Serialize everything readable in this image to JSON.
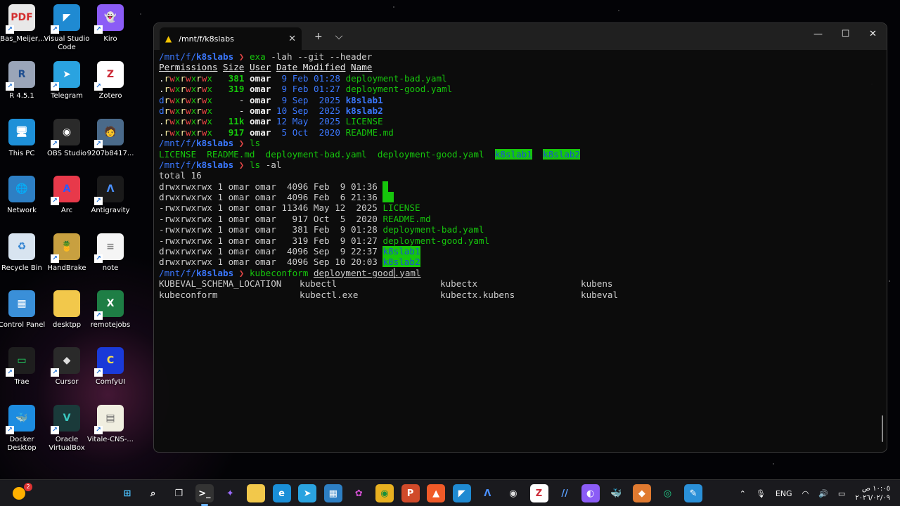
{
  "desktop": {
    "icons": [
      {
        "label": "_Bas_Meijer,...",
        "glyph": "PDF",
        "bg": "#e8e8e8",
        "fg": "#d32f2f"
      },
      {
        "label": "Visual Studio Code",
        "glyph": "◤",
        "bg": "#1f8ad2",
        "fg": "#ffffff"
      },
      {
        "label": "Kiro",
        "glyph": "👻",
        "bg": "#8b5cf6",
        "fg": "#ffffff"
      },
      {
        "label": "R 4.5.1",
        "glyph": "R",
        "bg": "#9aa5b8",
        "fg": "#1d4d8f"
      },
      {
        "label": "Telegram",
        "glyph": "➤",
        "bg": "#2aa3e0",
        "fg": "#ffffff"
      },
      {
        "label": "Zotero",
        "glyph": "Z",
        "bg": "#ffffff",
        "fg": "#cc2936"
      },
      {
        "label": "This PC",
        "glyph": "🖥",
        "bg": "#1e90d8",
        "fg": "#ffffff"
      },
      {
        "label": "OBS Studio",
        "glyph": "◉",
        "bg": "#2a2a2a",
        "fg": "#ffffff"
      },
      {
        "label": "9207b8417...",
        "glyph": "🧑",
        "bg": "#4a6a8a",
        "fg": "#ffffff"
      },
      {
        "label": "Network",
        "glyph": "🌐",
        "bg": "#2d7fc4",
        "fg": "#ffffff"
      },
      {
        "label": "Arc",
        "glyph": "A",
        "bg": "#e8394a",
        "fg": "#2d5bff"
      },
      {
        "label": "Antigravity",
        "glyph": "Λ",
        "bg": "#1a1a1a",
        "fg": "#4a90ff"
      },
      {
        "label": "Recycle Bin",
        "glyph": "♻",
        "bg": "#d8e4f0",
        "fg": "#2a7fd0"
      },
      {
        "label": "HandBrake",
        "glyph": "🍍",
        "bg": "#c8a040",
        "fg": "#ffffff"
      },
      {
        "label": "note",
        "glyph": "≡",
        "bg": "#f5f5f5",
        "fg": "#888888"
      },
      {
        "label": "Control Panel",
        "glyph": "▦",
        "bg": "#3a8fd8",
        "fg": "#ffffff"
      },
      {
        "label": "desktpp",
        "glyph": "",
        "bg": "#f2c84b",
        "fg": "#ffffff"
      },
      {
        "label": "remotejobs",
        "glyph": "X",
        "bg": "#1e7e45",
        "fg": "#ffffff"
      },
      {
        "label": "Trae",
        "glyph": "▭",
        "bg": "#1e1e1e",
        "fg": "#22dd66"
      },
      {
        "label": "Cursor",
        "glyph": "◆",
        "bg": "#2a2a2a",
        "fg": "#dddddd"
      },
      {
        "label": "ComfyUI",
        "glyph": "C",
        "bg": "#1a3ad8",
        "fg": "#ffe14a"
      },
      {
        "label": "Docker Desktop",
        "glyph": "🐳",
        "bg": "#1d8ce0",
        "fg": "#ffffff"
      },
      {
        "label": "Oracle VirtualBox",
        "glyph": "V",
        "bg": "#1a3a3a",
        "fg": "#3ac8c0"
      },
      {
        "label": "Vitale-CNS-...",
        "glyph": "▤",
        "bg": "#f0eee0",
        "fg": "#666666"
      }
    ]
  },
  "terminal": {
    "tab_title": "/mnt/f/k8slabs",
    "tab_icon": "penguin-icon",
    "new_tab": "+",
    "dropdown": "⌵",
    "controls": {
      "minimize": "—",
      "maximize": "☐",
      "close": "✕"
    },
    "prompt_path": "/mnt/f/",
    "prompt_dir": "k8slabs",
    "prompt_char": "❯",
    "cmd1": {
      "cmd": "exa",
      "args": " -lah --git --header"
    },
    "exa_header": [
      "Permissions",
      "Size",
      "User",
      "Date Modified",
      "Name"
    ],
    "exa_rows": [
      {
        "type": ".",
        "perm": "rwxrwxrwx",
        "size": "381",
        "user": "omar",
        "date": " 9 Feb 01:28",
        "name": "deployment-bad.yaml",
        "dir": false
      },
      {
        "type": ".",
        "perm": "rwxrwxrwx",
        "size": "319",
        "user": "omar",
        "date": " 9 Feb 01:27",
        "name": "deployment-good.yaml",
        "dir": false
      },
      {
        "type": "d",
        "perm": "rwxrwxrwx",
        "size": "-",
        "user": "omar",
        "date": " 9 Sep  2025",
        "name": "k8slab1",
        "dir": true
      },
      {
        "type": "d",
        "perm": "rwxrwxrwx",
        "size": "-",
        "user": "omar",
        "date": "10 Sep  2025",
        "name": "k8slab2",
        "dir": true
      },
      {
        "type": ".",
        "perm": "rwxrwxrwx",
        "size": "11k",
        "user": "omar",
        "date": "12 May  2025",
        "name": "LICENSE",
        "dir": false
      },
      {
        "type": ".",
        "perm": "rwxrwxrwx",
        "size": "917",
        "user": "omar",
        "date": " 5 Oct  2020",
        "name": "README.md",
        "dir": false
      }
    ],
    "cmd2": {
      "cmd": "ls"
    },
    "ls_files": [
      "LICENSE",
      "README.md",
      "deployment-bad.yaml",
      "deployment-good.yaml"
    ],
    "ls_dirs": [
      "k8slab1",
      "k8slab2"
    ],
    "cmd3": {
      "cmd": "ls",
      "args": " -al"
    },
    "total": "total 16",
    "lsal_rows": [
      {
        "meta": "drwxrwxrwx 1 omar omar  4096 Feb  9 01:36 ",
        "name": ".",
        "kind": "block"
      },
      {
        "meta": "drwxrwxrwx 1 omar omar  4096 Feb  6 21:36 ",
        "name": "..",
        "kind": "block"
      },
      {
        "meta": "-rwxrwxrwx 1 omar omar 11346 May 12  2025 ",
        "name": "LICENSE",
        "kind": "file"
      },
      {
        "meta": "-rwxrwxrwx 1 omar omar   917 Oct  5  2020 ",
        "name": "README.md",
        "kind": "file"
      },
      {
        "meta": "-rwxrwxrwx 1 omar omar   381 Feb  9 01:28 ",
        "name": "deployment-bad.yaml",
        "kind": "file"
      },
      {
        "meta": "-rwxrwxrwx 1 omar omar   319 Feb  9 01:27 ",
        "name": "deployment-good.yaml",
        "kind": "file"
      },
      {
        "meta": "drwxrwxrwx 1 omar omar  4096 Sep  9 22:37 ",
        "name": "k8slab1",
        "kind": "dir"
      },
      {
        "meta": "drwxrwxrwx 1 omar omar  4096 Sep 10 20:03 ",
        "name": "k8slab2",
        "kind": "dir"
      }
    ],
    "cmd4": {
      "cmd": "kubeconform",
      "arg_before_cursor": "deployment-good",
      "arg_after_cursor": ".yaml"
    },
    "completions": [
      [
        "KUBEVAL_SCHEMA_LOCATION",
        "kubectl",
        "kubectx",
        "kubens"
      ],
      [
        "kubeconform",
        "kubectl.exe",
        "kubectx.kubens",
        "kubeval"
      ]
    ]
  },
  "taskbar": {
    "weather_badge": "2",
    "apps": [
      {
        "name": "start-icon",
        "glyph": "⊞",
        "bg": "transparent",
        "fg": "#4cc2ff"
      },
      {
        "name": "search-icon",
        "glyph": "⌕",
        "bg": "transparent",
        "fg": "#ffffff"
      },
      {
        "name": "task-view-icon",
        "glyph": "❐",
        "bg": "transparent",
        "fg": "#dddddd"
      },
      {
        "name": "terminal-icon",
        "glyph": ">_",
        "bg": "#333333",
        "fg": "#ffffff",
        "active": true
      },
      {
        "name": "copilot-icon",
        "glyph": "✦",
        "bg": "transparent",
        "fg": "#9b6bff"
      },
      {
        "name": "file-explorer-icon",
        "glyph": "▬",
        "bg": "#f2c84b",
        "fg": "#f2c84b"
      },
      {
        "name": "edge-icon",
        "glyph": "e",
        "bg": "#1a8fd8",
        "fg": "#ffffff"
      },
      {
        "name": "telegram-icon",
        "glyph": "➤",
        "bg": "#2aa3e0",
        "fg": "#ffffff"
      },
      {
        "name": "store-icon",
        "glyph": "▦",
        "bg": "#2d7fc4",
        "fg": "#ffffff"
      },
      {
        "name": "app-icon",
        "glyph": "✿",
        "bg": "transparent",
        "fg": "#d050d0"
      },
      {
        "name": "chrome-icon",
        "glyph": "◉",
        "bg": "#e8b020",
        "fg": "#1a8f3a"
      },
      {
        "name": "powerpoint-icon",
        "glyph": "P",
        "bg": "#d04a2a",
        "fg": "#ffffff"
      },
      {
        "name": "brave-icon",
        "glyph": "▲",
        "bg": "#f05a28",
        "fg": "#ffffff"
      },
      {
        "name": "vscode-icon",
        "glyph": "◤",
        "bg": "#1f8ad2",
        "fg": "#ffffff"
      },
      {
        "name": "antigravity-icon",
        "glyph": "Λ",
        "bg": "transparent",
        "fg": "#4a90ff"
      },
      {
        "name": "obs-icon",
        "glyph": "◉",
        "bg": "transparent",
        "fg": "#dddddd"
      },
      {
        "name": "zotero-icon",
        "glyph": "Z",
        "bg": "#ffffff",
        "fg": "#cc2936"
      },
      {
        "name": "slash-app-icon",
        "glyph": "//",
        "bg": "transparent",
        "fg": "#5aa0ff"
      },
      {
        "name": "kiro-icon",
        "glyph": "◐",
        "bg": "#8b5cf6",
        "fg": "#ffffff"
      },
      {
        "name": "docker-icon",
        "glyph": "🐳",
        "bg": "transparent",
        "fg": "#1d8ce0"
      },
      {
        "name": "handbrake-icon",
        "glyph": "◆",
        "bg": "#e07a30",
        "fg": "#ffffff"
      },
      {
        "name": "chatgpt-icon",
        "glyph": "◎",
        "bg": "transparent",
        "fg": "#22d08a"
      },
      {
        "name": "paint-icon",
        "glyph": "✎",
        "bg": "#2a90d8",
        "fg": "#ffffff"
      }
    ],
    "tray": {
      "chevron": "⌃",
      "mic": "🎙",
      "lang": "ENG",
      "wifi": "◠",
      "volume": "🔊",
      "battery": "▭",
      "time": "١٠:٠٥ ص",
      "date": "٢٠٢٦/٠٢/٠٩"
    }
  }
}
